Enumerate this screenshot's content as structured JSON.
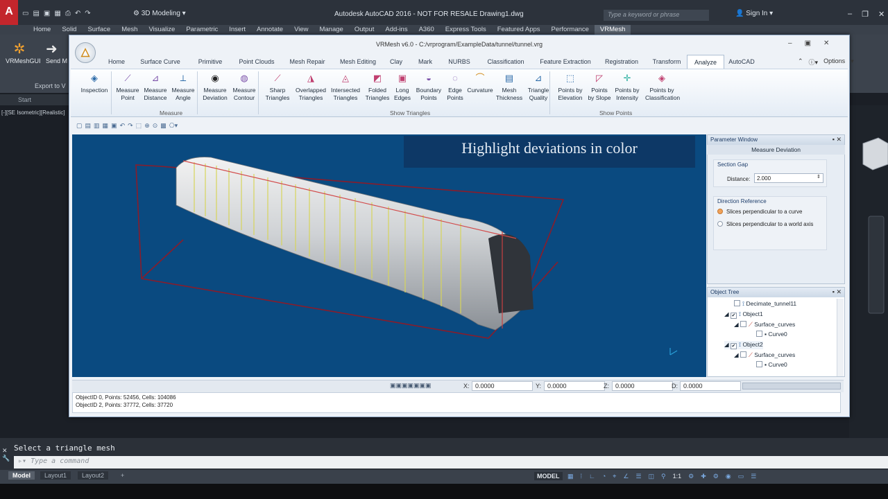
{
  "acad": {
    "logo": "A",
    "workspace": "3D Modeling",
    "title": "Autodesk AutoCAD 2016 - NOT FOR RESALE    Drawing1.dwg",
    "search_placeholder": "Type a keyword or phrase",
    "signin": "Sign In",
    "tabs": [
      "Home",
      "Solid",
      "Surface",
      "Mesh",
      "Visualize",
      "Parametric",
      "Insert",
      "Annotate",
      "View",
      "Manage",
      "Output",
      "Add-ins",
      "A360",
      "Express Tools",
      "Featured Apps",
      "Performance",
      "VRMesh"
    ],
    "ribbon_vrm": "VRMeshGUI",
    "ribbon_send": "Send M",
    "ribbon_export": "Export to V",
    "start_tab": "Start",
    "viewport_label": "[-][SE Isometric][Realistic]",
    "cmd_prompt": "Select a triangle mesh",
    "cmd_placeholder": "Type a command",
    "layout_tabs": [
      "Model",
      "Layout1",
      "Layout2"
    ],
    "status_model": "MODEL",
    "scale": "1:1"
  },
  "vr": {
    "title": "VRMesh v6.0 - C:/vrprogram/ExampleData/tunnel/tunnel.vrg",
    "tabs": [
      "Home",
      "Surface Curve",
      "Primitive",
      "Point Clouds",
      "Mesh Repair",
      "Mesh Editing",
      "Clay",
      "Mark",
      "NURBS",
      "Classification",
      "Feature Extraction",
      "Registration",
      "Transform",
      "Analyze",
      "AutoCAD"
    ],
    "options": "Options",
    "ribbon": [
      {
        "l1": "Inspection",
        "l2": ""
      },
      {
        "l1": "Measure",
        "l2": "Point"
      },
      {
        "l1": "Measure",
        "l2": "Distance"
      },
      {
        "l1": "Measure",
        "l2": "Angle"
      },
      {
        "l1": "Measure",
        "l2": "Deviation"
      },
      {
        "l1": "Measure",
        "l2": "Contour"
      },
      {
        "l1": "Sharp",
        "l2": "Triangles"
      },
      {
        "l1": "Overlapped",
        "l2": "Triangles"
      },
      {
        "l1": "Intersected",
        "l2": "Triangles"
      },
      {
        "l1": "Folded",
        "l2": "Triangles"
      },
      {
        "l1": "Long",
        "l2": "Edges"
      },
      {
        "l1": "Boundary",
        "l2": "Points"
      },
      {
        "l1": "Edge",
        "l2": "Points"
      },
      {
        "l1": "Curvature",
        "l2": ""
      },
      {
        "l1": "Mesh",
        "l2": "Thickness"
      },
      {
        "l1": "Triangle",
        "l2": "Quality"
      },
      {
        "l1": "Points by",
        "l2": "Elevation"
      },
      {
        "l1": "Points",
        "l2": "by Slope"
      },
      {
        "l1": "Points by",
        "l2": "Intensity"
      },
      {
        "l1": "Points by",
        "l2": "Classification"
      }
    ],
    "groups": [
      "Measure",
      "Show Triangles",
      "Show Points"
    ],
    "banner": "Highlight deviations in color",
    "coords": {
      "x_label": "X:",
      "x": "0.0000",
      "y_label": "Y:",
      "y": "0.0000",
      "z_label": "Z:",
      "z": "0.0000",
      "d_label": "D:",
      "d": "0.0000"
    },
    "log": [
      "ObjectID 0, Points: 52456, Cells: 104086",
      "ObjectID 2, Points: 37772, Cells: 37720"
    ]
  },
  "param": {
    "header": "Parameter Window",
    "subtitle": "Measure Deviation",
    "section_gap": "Section Gap",
    "distance_label": "Distance:",
    "distance_value": "2.000",
    "direction_ref": "Direction Reference",
    "opt1": "Slices perpendicular to a curve",
    "opt2": "Slices perpendicular to a world axis"
  },
  "tree": {
    "header": "Object Tree",
    "items": [
      "Decimate_tunnel11",
      "Object1",
      "Surface_curves",
      "Curve0",
      "Object2",
      "Surface_curves",
      "Curve0"
    ]
  },
  "colors": {
    "viewport": "#0a4a80",
    "accent": "#f0b040"
  }
}
